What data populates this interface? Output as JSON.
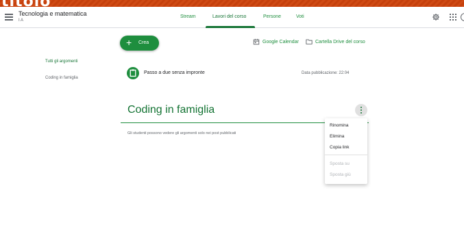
{
  "slide": {
    "title": "titolo"
  },
  "header": {
    "course_name": "Tecnologia e matematica",
    "course_section": "I A",
    "tabs": [
      {
        "label": "Stream",
        "active": false
      },
      {
        "label": "Lavori del corso",
        "active": true
      },
      {
        "label": "Persone",
        "active": false
      },
      {
        "label": "Voti",
        "active": false
      }
    ]
  },
  "sidebar": {
    "items": [
      {
        "label": "Tutti gli argomenti",
        "active": true
      },
      {
        "label": "Coding in famiglia",
        "active": false
      }
    ]
  },
  "toolbar": {
    "create_label": "Crea",
    "calendar_label": "Google Calendar",
    "drive_label": "Cartella Drive del corso"
  },
  "post": {
    "title": "Passo a due senza impronte",
    "date": "Data pubblicazione: 22:04"
  },
  "topic": {
    "title": "Coding in famiglia",
    "note": "Gli studenti possono vedere gli argomenti solo nei post pubblicati"
  },
  "context_menu": {
    "items": [
      {
        "label": "Rinomina",
        "enabled": true
      },
      {
        "label": "Elimina",
        "enabled": true
      },
      {
        "label": "Copia link",
        "enabled": true
      },
      {
        "label": "Sposta su",
        "enabled": false
      },
      {
        "label": "Sposta giù",
        "enabled": false
      }
    ]
  },
  "colors": {
    "accent": "#1e8e3e",
    "accent_dark": "#137333",
    "slide_background": "#c9420e"
  },
  "icons": [
    "menu-icon",
    "gear-icon",
    "apps-grid-icon",
    "calendar-icon",
    "folder-icon",
    "assignment-icon",
    "more-vert-icon",
    "plus-icon"
  ]
}
